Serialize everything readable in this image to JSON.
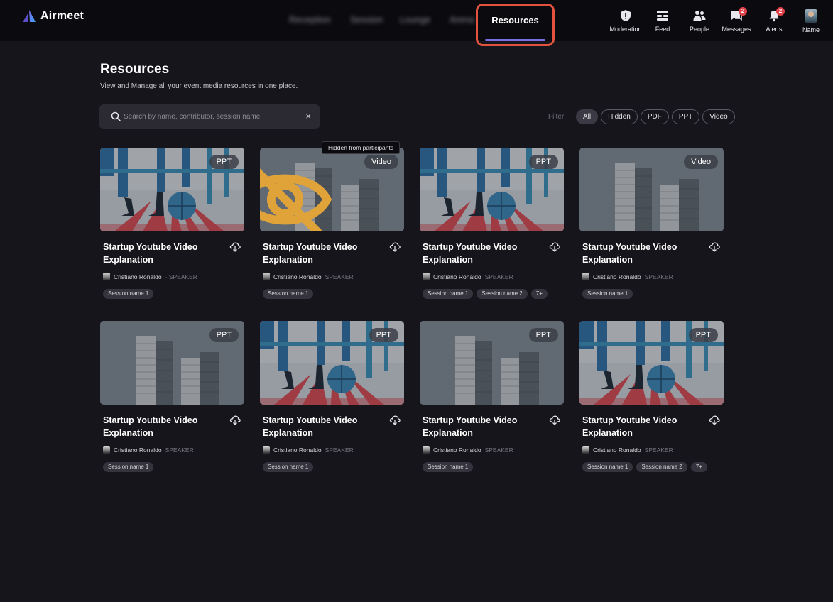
{
  "app": {
    "brand": "Airmeet",
    "nav": {
      "blurred_items": [
        "Reception",
        "Session",
        "Lounge",
        "Arena"
      ],
      "active_tab": "Resources"
    },
    "top_icons": [
      {
        "label": "Moderation",
        "icon": "shield-icon",
        "badge": ""
      },
      {
        "label": "Feed",
        "icon": "feed-icon",
        "badge": ""
      },
      {
        "label": "People",
        "icon": "people-icon",
        "badge": ""
      },
      {
        "label": "Messages",
        "icon": "messages-icon",
        "badge": "2"
      },
      {
        "label": "Alerts",
        "icon": "bell-icon",
        "badge": "2"
      },
      {
        "label": "Name",
        "icon": "avatar",
        "badge": ""
      }
    ]
  },
  "page": {
    "title": "Resources",
    "subtitle": "View and Manage all your event media resources in one place."
  },
  "search": {
    "placeholder": "Search by name, contributor, session name",
    "clear": "×"
  },
  "filter": {
    "label": "Filter",
    "options": [
      "All",
      "Hidden",
      "PDF",
      "PPT",
      "Video"
    ],
    "selected": "All"
  },
  "tooltip": "Hidden from participants",
  "cards": [
    {
      "type": "PPT",
      "image": "soccer",
      "title": "Startup Youtube Video Explanation",
      "contributor": "Cristiano Ronaldo",
      "role": "· SPEAKER",
      "sessions": [
        "Session name 1"
      ],
      "hidden": false
    },
    {
      "type": "Video",
      "image": "buildings",
      "title": "Startup Youtube Video Explanation",
      "contributor": "Cristiano Ronaldo",
      "role": "SPEAKER",
      "sessions": [
        "Session name 1"
      ],
      "hidden": true
    },
    {
      "type": "PPT",
      "image": "soccer",
      "title": "Startup Youtube Video Explanation",
      "contributor": "Cristiano Ronaldo",
      "role": "SPEAKER",
      "sessions": [
        "Session name 1",
        "Session name 2",
        "7+"
      ],
      "hidden": false
    },
    {
      "type": "Video",
      "image": "buildings",
      "title": "Startup Youtube Video Explanation",
      "contributor": "Cristiano Ronaldo",
      "role": "SPEAKER",
      "sessions": [
        "Session name 1"
      ],
      "hidden": false
    },
    {
      "type": "PPT",
      "image": "buildings",
      "title": "Startup Youtube Video Explanation",
      "contributor": "Cristiano Ronaldo",
      "role": "SPEAKER",
      "sessions": [
        "Session name 1"
      ],
      "hidden": false
    },
    {
      "type": "PPT",
      "image": "soccer",
      "title": "Startup Youtube Video Explanation",
      "contributor": "Cristiano Ronaldo",
      "role": "SPEAKER",
      "sessions": [
        "Session name 1"
      ],
      "hidden": false
    },
    {
      "type": "PPT",
      "image": "buildings",
      "title": "Startup Youtube Video Explanation",
      "contributor": "Cristiano Ronaldo",
      "role": "SPEAKER",
      "sessions": [
        "Session name 1"
      ],
      "hidden": false
    },
    {
      "type": "PPT",
      "image": "soccer",
      "title": "Startup Youtube Video Explanation",
      "contributor": "Cristiano Ronaldo",
      "role": "SPEAKER",
      "sessions": [
        "Session name 1",
        "Session name 2",
        "7+"
      ],
      "hidden": false
    }
  ],
  "colors": {
    "background": "#16151b",
    "accent": "#7a6ee6",
    "highlight_border": "#e2533f",
    "badge": "#e2434a"
  }
}
